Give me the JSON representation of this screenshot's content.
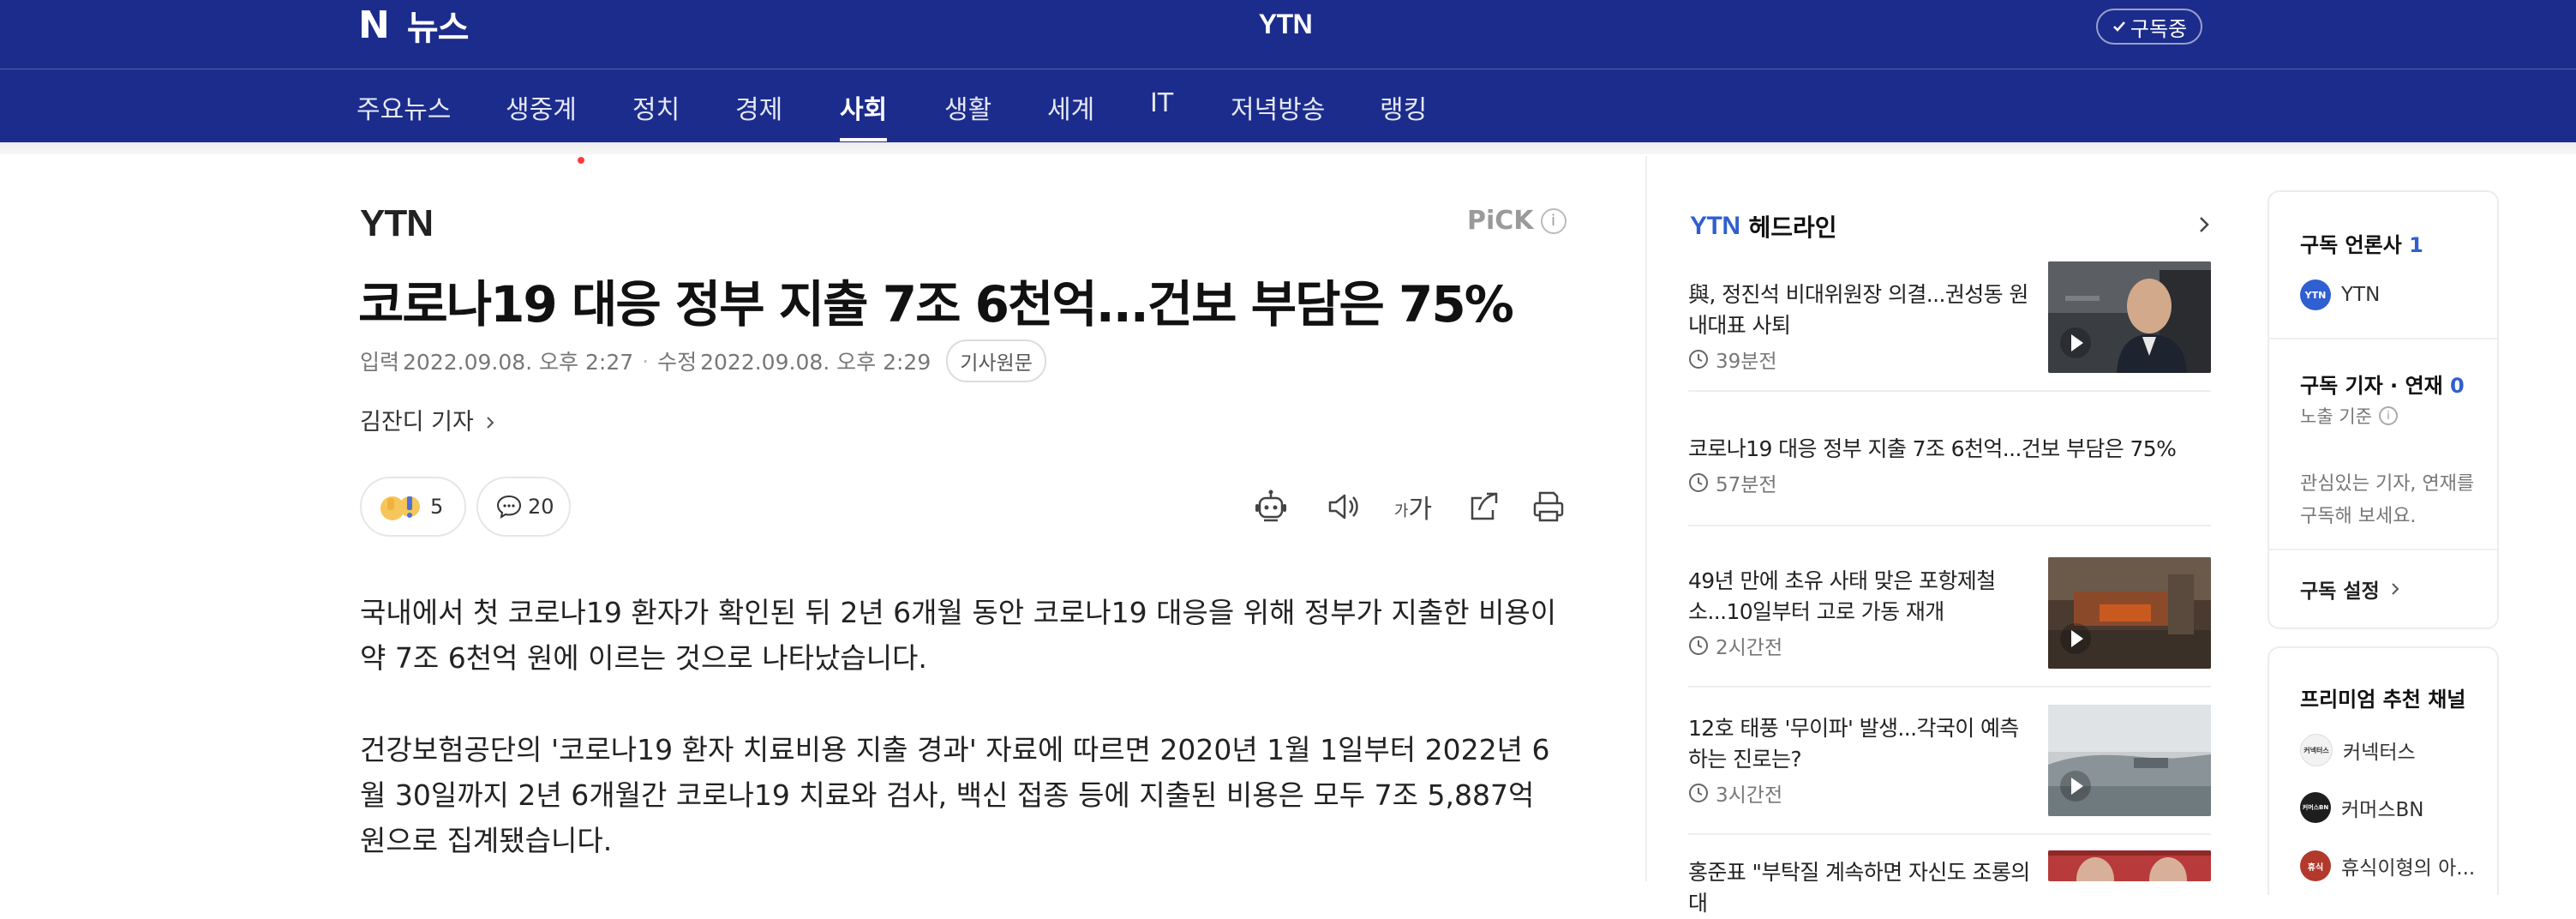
{
  "header": {
    "logo_mark": "N",
    "service_name": "뉴스",
    "press_name": "YTN",
    "subscribe_label": "구독중",
    "brand_color": "#1c2c8c"
  },
  "nav": {
    "items": [
      {
        "label": "주요뉴스"
      },
      {
        "label": "생중계",
        "has_dot": true
      },
      {
        "label": "정치"
      },
      {
        "label": "경제"
      },
      {
        "label": "사회",
        "active": true
      },
      {
        "label": "생활"
      },
      {
        "label": "세계"
      },
      {
        "label": "IT"
      },
      {
        "label": "저녁방송"
      },
      {
        "label": "랭킹"
      }
    ]
  },
  "article": {
    "press_logo": "YTN",
    "pick_label": "PiCK",
    "headline": "코로나19 대응 정부 지출 7조 6천억...건보 부담은 75%",
    "input_label": "입력",
    "input_time": "2022.09.08. 오후 2:27",
    "edit_label": "수정",
    "edit_time": "2022.09.08. 오후 2:29",
    "original_label": "기사원문",
    "reporter": "김잔디 기자",
    "reaction_count": "5",
    "comment_count": "20",
    "tools": [
      "robot-summary-icon",
      "speaker-icon",
      "font-size-icon",
      "share-icon",
      "print-icon"
    ],
    "font_tool_label": "가",
    "paragraphs": [
      "국내에서 첫 코로나19 환자가 확인된 뒤 2년 6개월 동안 코로나19 대응을 위해 정부가 지출한 비용이 약 7조 6천억 원에 이르는 것으로 나타났습니다.",
      "건강보험공단의 '코로나19 환자 치료비용 지출 경과' 자료에 따르면 2020년 1월 1일부터 2022년 6월 30일까지 2년 6개월간 코로나19 치료와 검사, 백신 접종 등에 지출된 비용은 모두 7조 5,887억 원으로 집계됐습니다."
    ]
  },
  "headline_panel": {
    "press": "YTN",
    "title": "헤드라인",
    "items": [
      {
        "title": "與, 정진석 비대위원장 의결...권성동 원내대표 사퇴",
        "time": "39분전",
        "has_thumb": true
      },
      {
        "title": "코로나19 대응 정부 지출 7조 6천억...건보 부담은 75%",
        "time": "57분전",
        "has_thumb": false
      },
      {
        "title": "49년 만에 초유 사태 맞은 포항제철소...10일부터 고로 가동 재개",
        "time": "2시간전",
        "has_thumb": true
      },
      {
        "title": "12호 태풍 '무이파' 발생...각국이 예측하는 진로는?",
        "time": "3시간전",
        "has_thumb": true
      },
      {
        "title": "홍준표 \"부탁질 계속하면 자신도 조롱의 대",
        "time": "",
        "has_thumb": true
      }
    ]
  },
  "subscription": {
    "press_header": "구독 언론사",
    "press_count": "1",
    "press_name": "YTN",
    "reporter_header": "구독 기자 · 연재",
    "reporter_count": "0",
    "exposure_label": "노출 기준",
    "empty_message": "관심있는 기자, 연재를 구독해 보세요.",
    "settings_label": "구독 설정"
  },
  "premium": {
    "header": "프리미엄 추천 채널",
    "channels": [
      {
        "name": "커넥터스",
        "badge": "커넥터스"
      },
      {
        "name": "커머스BN",
        "badge": "커머스BN"
      },
      {
        "name": "휴식이형의 아...",
        "badge": "휴식"
      }
    ]
  },
  "colors": {
    "accent_blue": "#2f5fd1",
    "live_dot": "#ff3b3b"
  }
}
